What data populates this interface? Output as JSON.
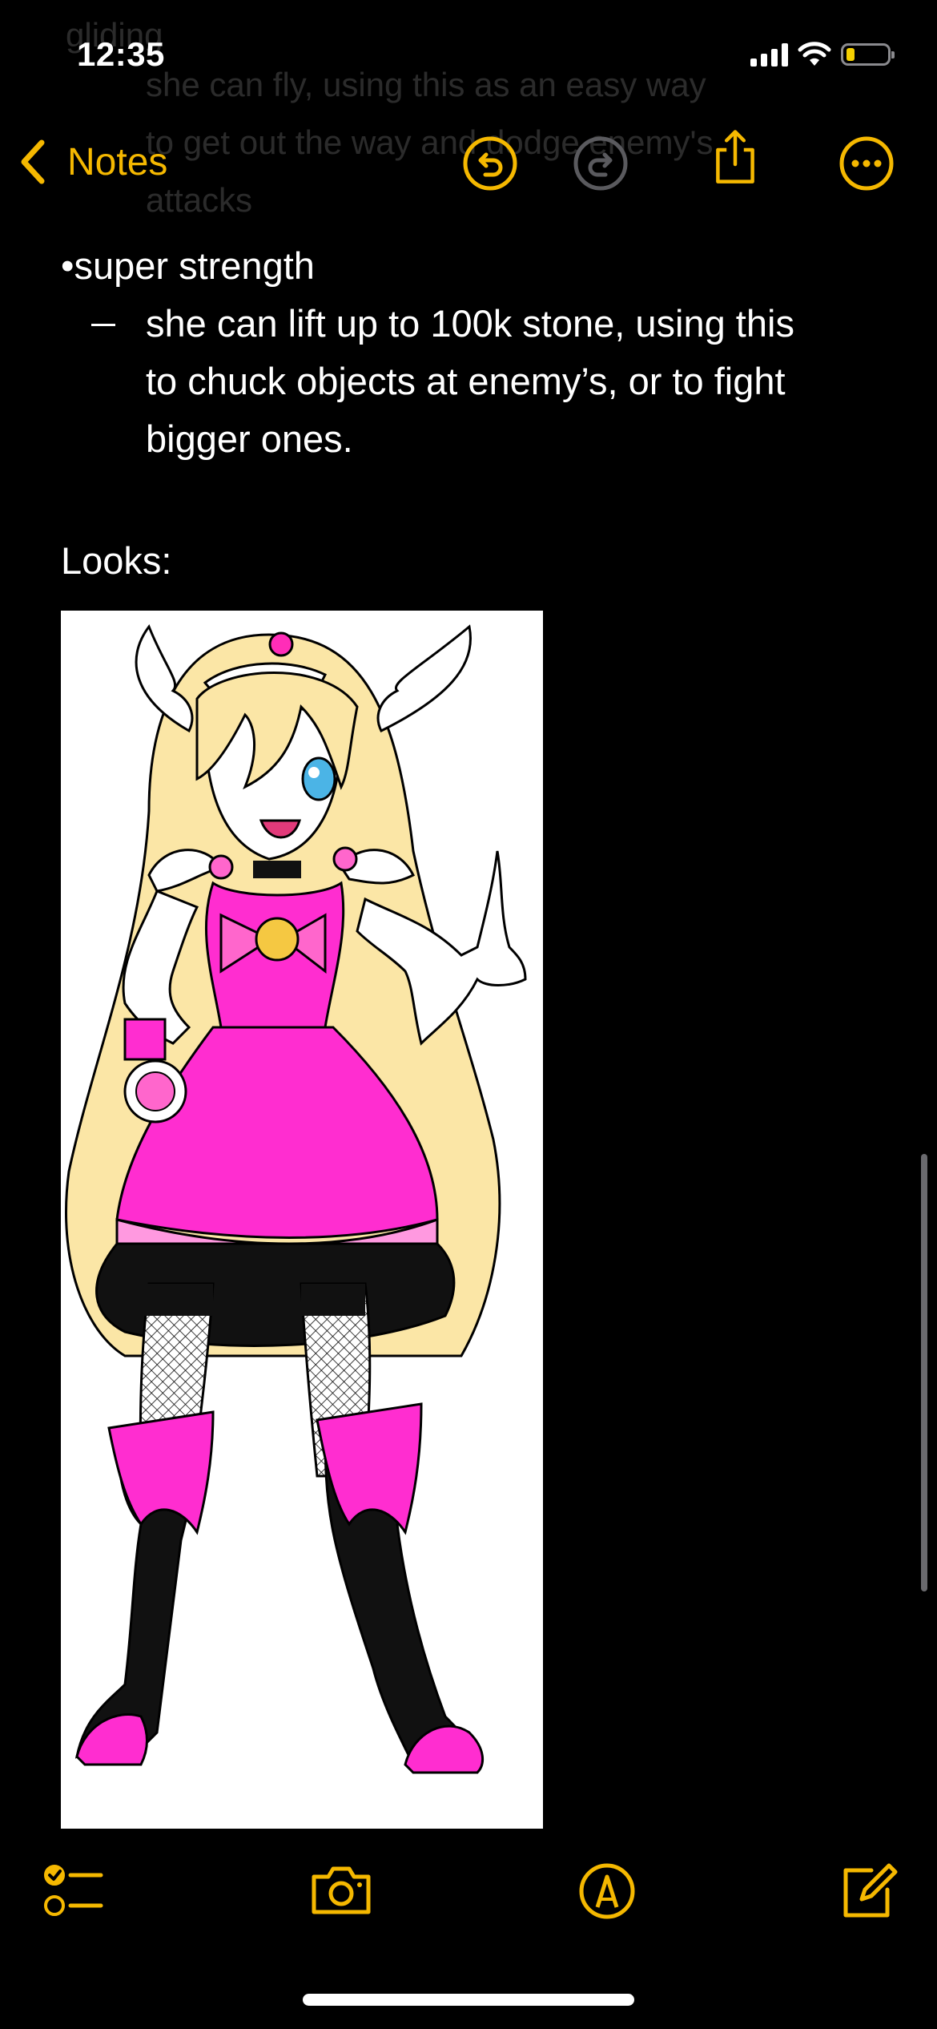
{
  "status_bar": {
    "time": "12:35",
    "battery_level": 0.2
  },
  "ghost_text": {
    "line0": "gliding",
    "line1": "she can fly, using this as an easy way",
    "line2": "to get out the way and dodge enemy's",
    "line3": "attacks"
  },
  "nav": {
    "back_label": "Notes",
    "icons": [
      "chevron-left-icon",
      "undo-icon",
      "redo-icon",
      "share-icon",
      "more-icon"
    ]
  },
  "note": {
    "bullet": "•super strength",
    "sub_lines": [
      "she can lift up to 100k stone, using this",
      "to chuck objects at enemy’s, or to fight",
      "bigger ones."
    ],
    "looks_label": "Looks:"
  },
  "toolbar": {
    "icons": [
      "checklist-icon",
      "camera-icon",
      "markup-icon",
      "compose-icon"
    ]
  },
  "colors": {
    "accent": "#f5b800",
    "background": "#000000",
    "text": "#ffffff",
    "disabled": "#5a5a5e"
  }
}
